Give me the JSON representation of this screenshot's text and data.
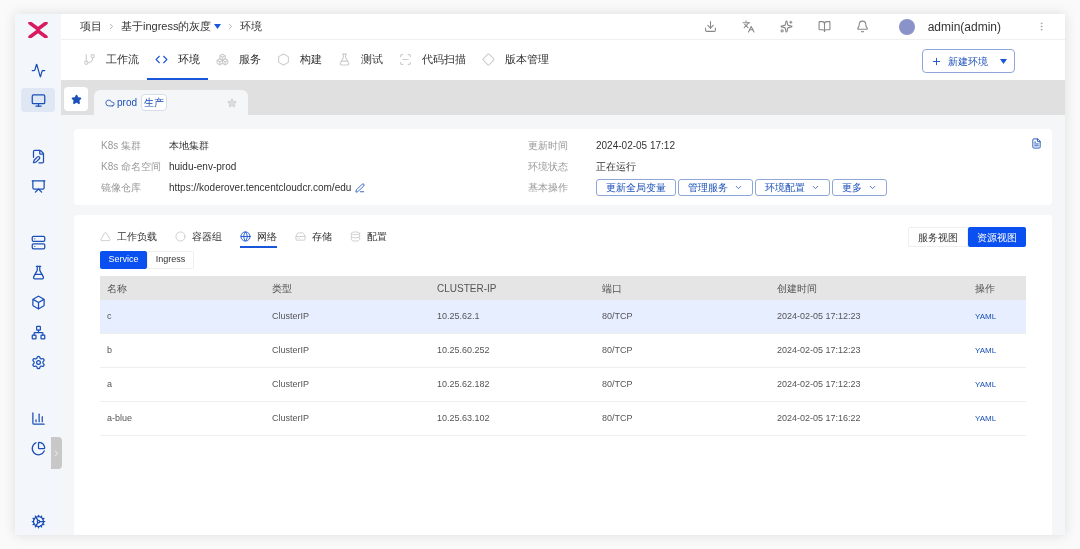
{
  "breadcrumb": [
    {
      "label": "项目",
      "dropdown": false
    },
    {
      "label": "基于ingress的灰度",
      "dropdown": true
    },
    {
      "label": "环境",
      "dropdown": false
    }
  ],
  "user": {
    "name": "admin(admin)"
  },
  "sidebar": {
    "groups": [
      [
        {
          "selected": false
        },
        {
          "selected": true
        }
      ],
      [
        {
          "selected": false
        },
        {
          "selected": false
        }
      ],
      [
        {
          "selected": false
        },
        {
          "selected": false
        },
        {
          "selected": false
        },
        {
          "selected": false
        },
        {
          "selected": false
        }
      ],
      [
        {
          "selected": false
        },
        {
          "selected": false
        }
      ]
    ]
  },
  "nav_tabs": [
    {
      "label": "工作流",
      "selected": false
    },
    {
      "label": "环境",
      "selected": true
    },
    {
      "label": "服务",
      "selected": false
    },
    {
      "label": "构建",
      "selected": false
    },
    {
      "label": "测试",
      "selected": false
    },
    {
      "label": "代码扫描",
      "selected": false
    },
    {
      "label": "版本管理",
      "selected": false
    }
  ],
  "new_button": "新建环境",
  "env_tab": {
    "name": "prod",
    "tag": "生产"
  },
  "info_left": [
    {
      "label": "K8s 集群",
      "value": "本地集群"
    },
    {
      "label": "K8s 命名空间",
      "value": "huidu-env-prod"
    },
    {
      "label": "镜像仓库",
      "value": "https://koderover.tencentcloudcr.com/edu"
    }
  ],
  "info_right": [
    {
      "label": "更新时间",
      "value": "2024-02-05 17:12"
    },
    {
      "label": "环境状态",
      "value": "正在运行"
    }
  ],
  "operations": {
    "label": "基本操作",
    "buttons": [
      {
        "label": "更新全局变量",
        "dropdown": false
      },
      {
        "label": "管理服务",
        "dropdown": true
      },
      {
        "label": "环境配置",
        "dropdown": true
      },
      {
        "label": "更多",
        "dropdown": true
      }
    ]
  },
  "resource_tabs": [
    {
      "label": "工作负载",
      "selected": false
    },
    {
      "label": "容器组",
      "selected": false
    },
    {
      "label": "网络",
      "selected": true
    },
    {
      "label": "存储",
      "selected": false
    },
    {
      "label": "配置",
      "selected": false
    }
  ],
  "view_toggle": [
    {
      "label": "服务视图",
      "selected": false
    },
    {
      "label": "资源视图",
      "selected": true
    }
  ],
  "segments": [
    {
      "label": "Service",
      "selected": true
    },
    {
      "label": "Ingress",
      "selected": false
    }
  ],
  "table": {
    "columns": [
      "名称",
      "类型",
      "CLUSTER-IP",
      "端口",
      "创建时间",
      "操作"
    ],
    "rows": [
      {
        "cells": [
          "c",
          "ClusterIP",
          "10.25.62.1",
          "80/TCP",
          "2024-02-05 17:12:23"
        ],
        "action": "YAML",
        "selected": true
      },
      {
        "cells": [
          "b",
          "ClusterIP",
          "10.25.60.252",
          "80/TCP",
          "2024-02-05 17:12:23"
        ],
        "action": "YAML",
        "selected": false
      },
      {
        "cells": [
          "a",
          "ClusterIP",
          "10.25.62.182",
          "80/TCP",
          "2024-02-05 17:12:23"
        ],
        "action": "YAML",
        "selected": false
      },
      {
        "cells": [
          "a-blue",
          "ClusterIP",
          "10.25.63.102",
          "80/TCP",
          "2024-02-05 17:16:22"
        ],
        "action": "YAML",
        "selected": false
      }
    ]
  }
}
